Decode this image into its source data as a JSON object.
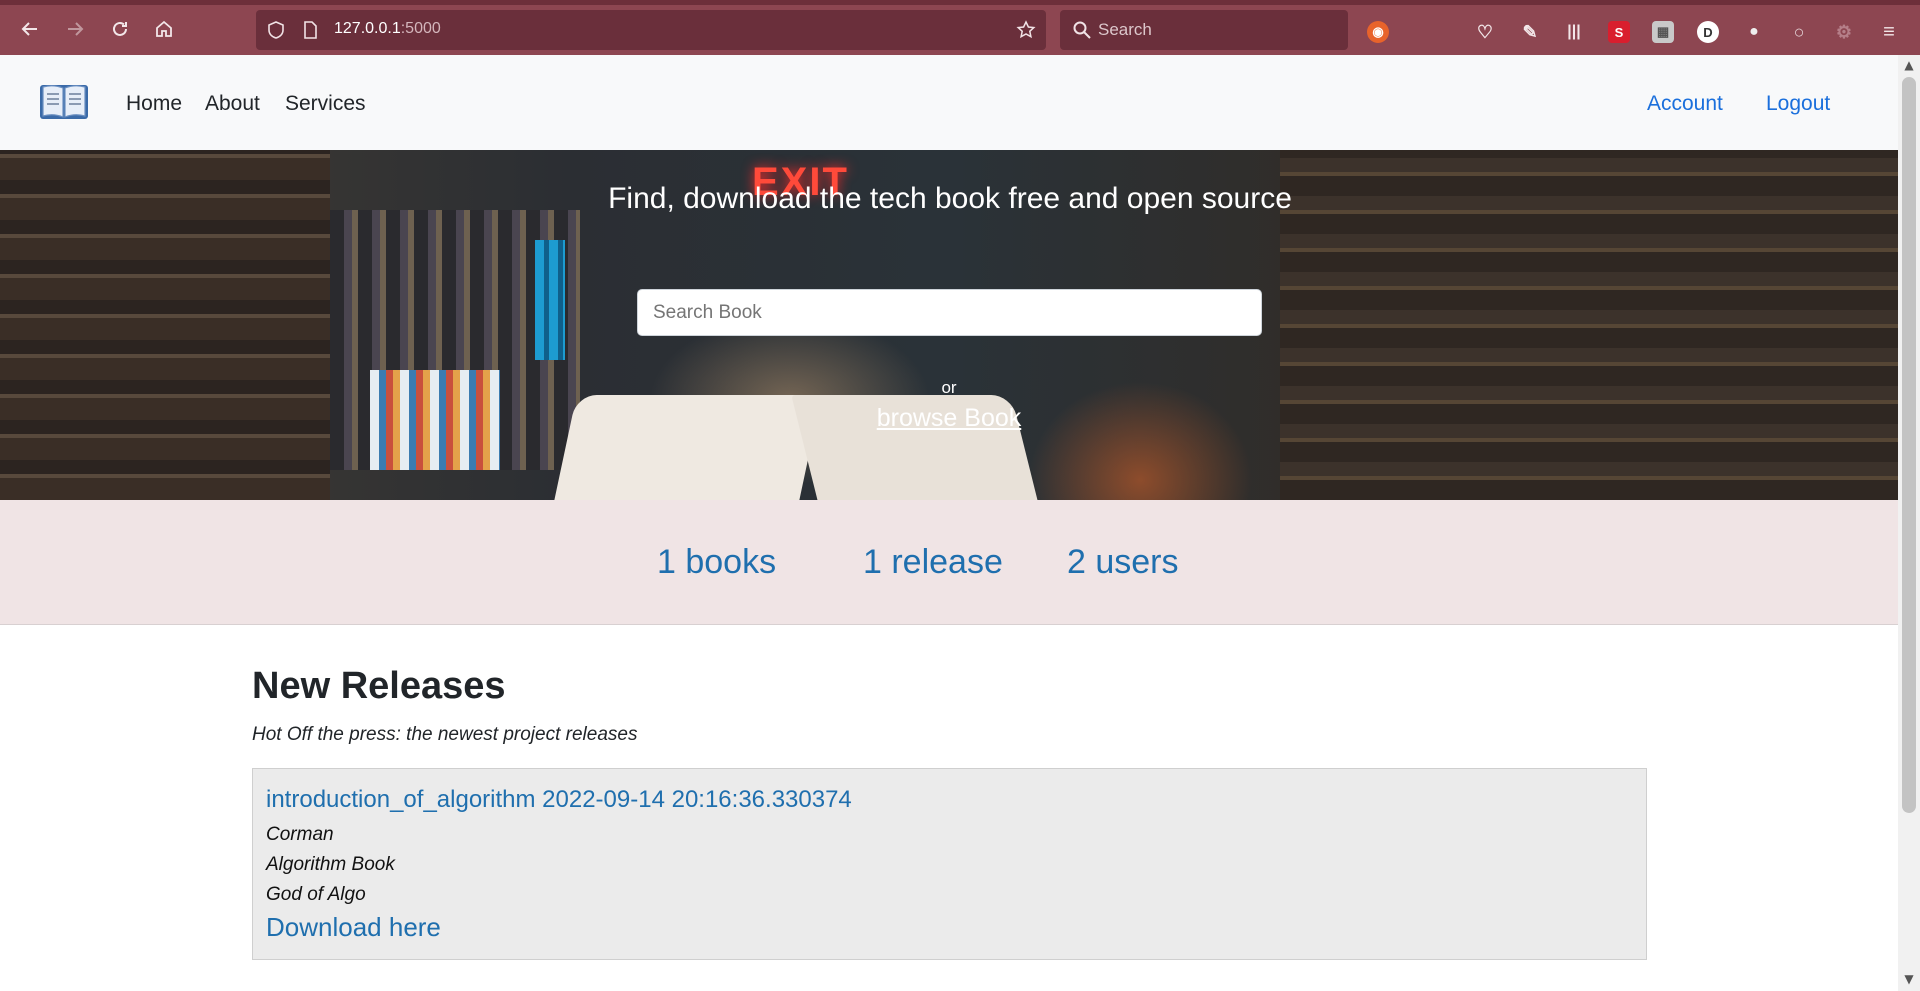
{
  "browser": {
    "url_host": "127.0.0.1",
    "url_port": ":5000",
    "search_placeholder": "Search",
    "extensions": [
      {
        "name": "S",
        "color": "#d91e2e"
      },
      {
        "name": "D",
        "color": "#ffffff"
      }
    ]
  },
  "nav": {
    "links": [
      "Home",
      "About",
      "Services"
    ],
    "account": "Account",
    "logout": "Logout"
  },
  "hero": {
    "title": "Find, download the tech book free and open source",
    "search_placeholder": "Search Book",
    "or_text": "or",
    "browse_link": "browse Book",
    "sign_text": "EXIT"
  },
  "stats": {
    "books": "1 books",
    "releases": "1 release",
    "users": "2 users"
  },
  "releases": {
    "heading": "New Releases",
    "subheading": "Hot Off the press: the newest project releases",
    "items": [
      {
        "title": "introduction_of_algorithm 2022-09-14 20:16:36.330374",
        "author": "Corman",
        "category": "Algorithm Book",
        "description": "God of Algo",
        "download": "Download here"
      }
    ]
  },
  "colors": {
    "chrome": "#8d4651",
    "link_blue": "#1f6fae",
    "nav_link_blue": "#1a6fdc",
    "stats_band": "#f0e4e5",
    "card_bg": "#ebebeb"
  }
}
